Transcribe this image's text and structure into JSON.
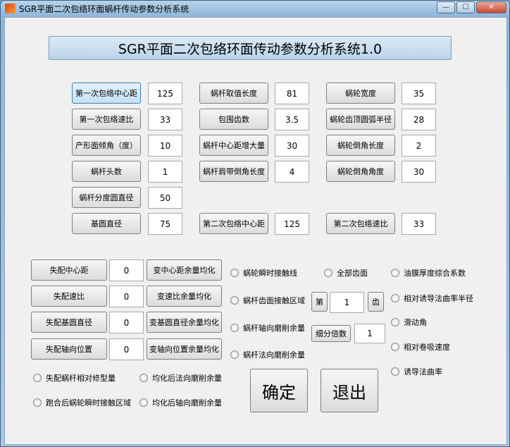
{
  "window": {
    "title": "SGR平面二次包络环面蜗杆传动参数分析系统",
    "minimize": "—",
    "maximize": "☐",
    "close": "✕"
  },
  "header": {
    "title": "SGR平面二次包络环面传动参数分析系统1.0"
  },
  "params": {
    "first_center_distance": {
      "label": "第一次包络中心距",
      "value": "125"
    },
    "first_ratio": {
      "label": "第一次包络速比",
      "value": "33"
    },
    "profile_angle": {
      "label": "产形面倾角（度）",
      "value": "10"
    },
    "worm_starts": {
      "label": "蜗杆头数",
      "value": "1"
    },
    "worm_pitch_diameter": {
      "label": "蜗杆分度圆直径",
      "value": "50"
    },
    "base_circle_diameter": {
      "label": "基圆直径",
      "value": "75"
    },
    "worm_length": {
      "label": "蜗杆取值长度",
      "value": "81"
    },
    "wrap_teeth": {
      "label": "包围齿数",
      "value": "3.5"
    },
    "center_increase": {
      "label": "蜗杆中心距增大量",
      "value": "30"
    },
    "shoulder_chamfer": {
      "label": "蜗杆肩带倒角长度",
      "value": "4"
    },
    "second_center_distance": {
      "label": "第二次包络中心距",
      "value": "125"
    },
    "wheel_width": {
      "label": "蜗轮宽度",
      "value": "35"
    },
    "wheel_tip_radius": {
      "label": "蜗轮齿顶圆弧半径",
      "value": "28"
    },
    "wheel_chamfer_length": {
      "label": "蜗轮倒角长度",
      "value": "2"
    },
    "wheel_chamfer_angle": {
      "label": "蜗轮倒角角度",
      "value": "30"
    },
    "second_ratio": {
      "label": "第二次包络速比",
      "value": "33"
    }
  },
  "mismatch": {
    "center": {
      "label": "失配中心距",
      "value": "0",
      "action": "变中心距余量均化"
    },
    "ratio": {
      "label": "失配速比",
      "value": "0",
      "action": "变速比余量均化"
    },
    "base": {
      "label": "失配基圆直径",
      "value": "0",
      "action": "变基圆直径余量均化"
    },
    "axial": {
      "label": "失配轴向位置",
      "value": "0",
      "action": "变轴向位置余量均化"
    }
  },
  "radios_left": {
    "mod_amount": "失配蜗杆相对修型量",
    "normal_after": "均化后法向磨削余量",
    "contact_after": "跑合后蜗轮瞬时接触区域",
    "axial_after": "均化后轴向磨削余量"
  },
  "radios_mid": {
    "contact_line": "蜗轮瞬时接触线",
    "all_teeth": "全部齿面",
    "worm_contact": "蜗杆齿面接触区域",
    "tooth_prefix": "第",
    "tooth_index": "1",
    "tooth_suffix": "齿",
    "worm_axial": "蜗杆轴向磨削余量",
    "subdiv_label": "细分倍数",
    "subdiv_value": "1",
    "worm_normal": "蜗杆法向磨削余量"
  },
  "radios_right": {
    "oil_film": "油膜厚度综合系数",
    "induced_radius": "相对诱导法曲率半径",
    "slide_angle": "滑动角",
    "entrain_speed": "相对卷吸速度",
    "induced_curvature": "诱导法曲率"
  },
  "actions": {
    "ok": "确定",
    "exit": "退出"
  }
}
